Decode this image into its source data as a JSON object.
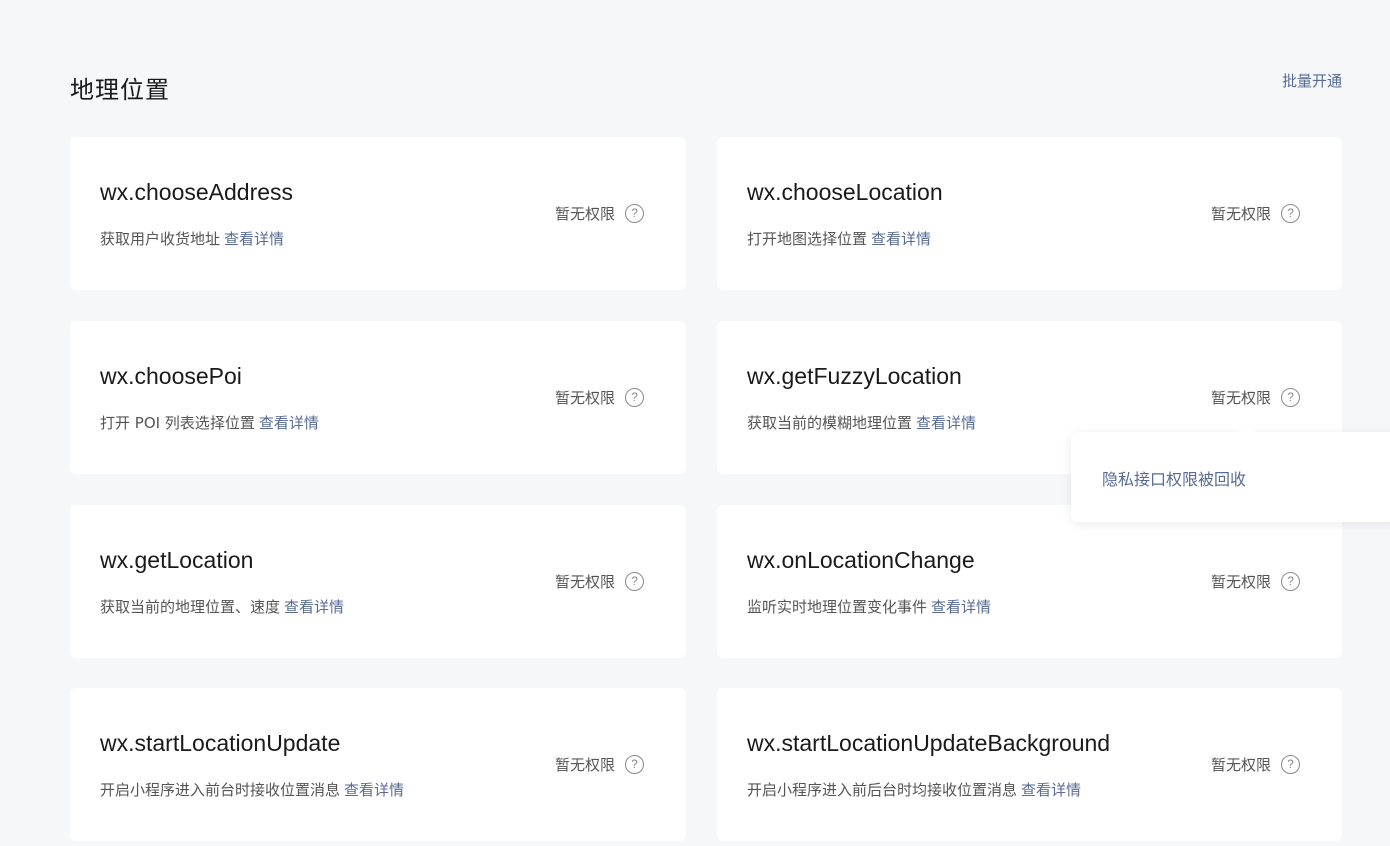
{
  "section": {
    "title": "地理位置",
    "batch_label": "批量开通"
  },
  "detail_label": "查看详情",
  "cards": [
    {
      "api": "wx.chooseAddress",
      "desc": "获取用户收货地址",
      "status": "暂无权限"
    },
    {
      "api": "wx.chooseLocation",
      "desc": "打开地图选择位置",
      "status": "暂无权限"
    },
    {
      "api": "wx.choosePoi",
      "desc": "打开 POI 列表选择位置",
      "status": "暂无权限"
    },
    {
      "api": "wx.getFuzzyLocation",
      "desc": "获取当前的模糊地理位置",
      "status": "暂无权限"
    },
    {
      "api": "wx.getLocation",
      "desc": "获取当前的地理位置、速度",
      "status": "暂无权限"
    },
    {
      "api": "wx.onLocationChange",
      "desc": "监听实时地理位置变化事件",
      "status": "暂无权限"
    },
    {
      "api": "wx.startLocationUpdate",
      "desc": "开启小程序进入前台时接收位置消息",
      "status": "暂无权限"
    },
    {
      "api": "wx.startLocationUpdateBackground",
      "desc": "开启小程序进入前后台时均接收位置消息",
      "status": "暂无权限"
    }
  ],
  "tooltip": {
    "text": "隐私接口权限被回收"
  },
  "help_icon_glyph": "?",
  "colors": {
    "link": "#576b95",
    "background": "#f6f7f9",
    "card": "#ffffff"
  }
}
